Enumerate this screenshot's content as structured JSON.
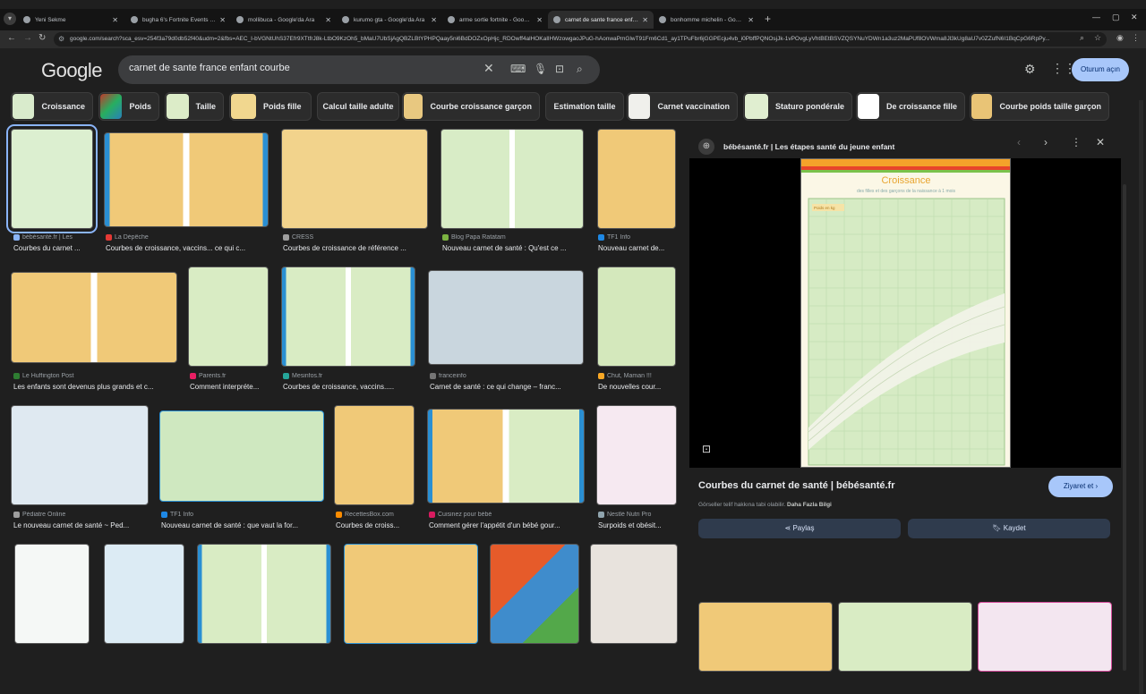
{
  "tabs": [
    {
      "title": "Yeni Sekme",
      "active": false
    },
    {
      "title": "bugha 6's Fortnite Events - Fort",
      "active": false
    },
    {
      "title": "mollibuca - Google'da Ara",
      "active": false
    },
    {
      "title": "kurumo gta - Google'da Ara",
      "active": false
    },
    {
      "title": "arme sortie fortnite - Google'da",
      "active": false
    },
    {
      "title": "carnet de sante france enfant c",
      "active": true
    },
    {
      "title": "bonhomme michelin - Google'da",
      "active": false
    }
  ],
  "address": {
    "url": "google.com/search?sca_esv=254f3a79d0db52f40&udm=2&fbs=AEC_I-bVGNtUhS37Efr9XTtfrJ8k-LtbO9KzOh5_bMaU7UbSjAgQBZLBtYPHPQaay5ni6BdDOZxOpHjc_RDOwff4alHOKaIlHWzowgaoJPuG-hAonwaPmGlwT91Fm6Cd1_ay1TPuFbr6jGGPEcju4vb_i0PbffPQNOsjJk-1vPOvgLyVhtBEtBSVZQSYNuYDWn1a3uz2MaPUf8OVWma8Jl3kUg8aU7v0ZZufN6I1BqCpG6RpPy..."
  },
  "google": {
    "logo": "Google",
    "query": "carnet de sante france enfant courbe",
    "signin": "Oturum açın"
  },
  "chips": [
    {
      "label": "Croissance",
      "thumb": "#d9ebcc"
    },
    {
      "label": "Poids",
      "thumb": "#c7e0a0"
    },
    {
      "label": "Taille",
      "thumb": "#dcecc8"
    },
    {
      "label": "Poids fille",
      "thumb": "#f1d78f"
    },
    {
      "label": "Calcul taille adulte",
      "thumb": ""
    },
    {
      "label": "Courbe croissance garçon",
      "thumb": "#e8c880"
    },
    {
      "label": "Estimation taille",
      "thumb": ""
    },
    {
      "label": "Carnet vaccination",
      "thumb": "#f0f0ec"
    },
    {
      "label": "Staturo pondérale",
      "thumb": "#e0eed0"
    },
    {
      "label": "De croissance fille",
      "thumb": "#ffffff"
    },
    {
      "label": "Courbe poids taille garçon",
      "thumb": "#e9c476"
    }
  ],
  "results": [
    {
      "source": "bébésanté.fr | Les",
      "caption": "Courbes du carnet ...",
      "favcolor": "#8ab4f8"
    },
    {
      "source": "La Dépêche",
      "caption": "Courbes de croissance, vaccins... ce qui c...",
      "favcolor": "#e53935"
    },
    {
      "source": "CRESS",
      "caption": "Courbes de croissance de référence ...",
      "favcolor": "#9e9e9e"
    },
    {
      "source": "Blog Papa Ratatam",
      "caption": "Nouveau carnet de santé : Qu'est ce ...",
      "favcolor": "#7cb342"
    },
    {
      "source": "TF1 Info",
      "caption": "Nouveau carnet de...",
      "favcolor": "#1e88e5"
    },
    {
      "source": "Le Huffington Post",
      "caption": "Les enfants sont devenus plus grands et c...",
      "favcolor": "#2e7d32"
    },
    {
      "source": "Parents.fr",
      "caption": "Comment interpréte...",
      "favcolor": "#e91e63"
    },
    {
      "source": "Mesinfos.fr",
      "caption": "Courbes de croissance, vaccins.....",
      "favcolor": "#26a69a"
    },
    {
      "source": "franceinfo",
      "caption": "Carnet de santé : ce qui change – franc...",
      "favcolor": "#757575"
    },
    {
      "source": "Chut, Maman !!!",
      "caption": "De nouvelles cour...",
      "favcolor": "#f9a825"
    },
    {
      "source": "Pédiatre Online",
      "caption": "Le nouveau carnet de santé ~ Ped...",
      "favcolor": "#9e9e9e"
    },
    {
      "source": "TF1 Info",
      "caption": "Nouveau carnet de santé : que vaut la for...",
      "favcolor": "#1e88e5"
    },
    {
      "source": "RecettesBox.com",
      "caption": "Courbes de croiss...",
      "favcolor": "#fb8c00"
    },
    {
      "source": "Cuisinez pour bébé",
      "caption": "Comment gérer l'appétit d'un bébé gour...",
      "favcolor": "#d81b60"
    },
    {
      "source": "Nestlé Nutri Pro",
      "caption": "Surpoids et obésit...",
      "favcolor": "#90a4ae"
    }
  ],
  "panel": {
    "site": "bébésanté.fr | Les étapes santé du jeune enfant",
    "caption": "Courbes du carnet de santé | bébésanté.fr",
    "visit": "Ziyaret et",
    "copyright": "Görseller telif hakkına tabi olabilir.",
    "more": "Daha Fazla Bilgi",
    "share": "Paylaş",
    "save": "Kaydet",
    "chart_title": "Croissance",
    "chart_subtitle": "des filles et des garçons de la naissance à 1 mois",
    "chart_label": "Poids en kg"
  },
  "colors": {
    "accent": "#a8c7fa",
    "chart_green": "#cfe6b8",
    "chart_orange": "#eec777"
  }
}
